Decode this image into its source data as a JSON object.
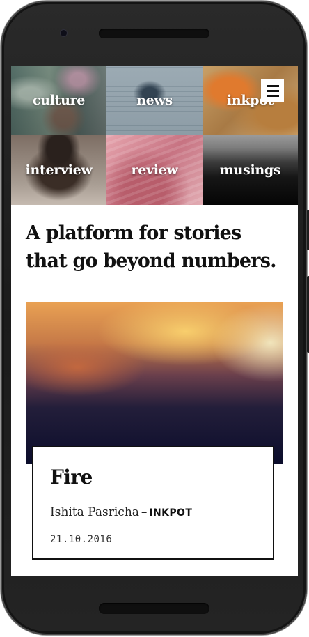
{
  "nav": {
    "tiles": [
      {
        "label": "culture"
      },
      {
        "label": "news"
      },
      {
        "label": "inkpot"
      },
      {
        "label": "interview"
      },
      {
        "label": "review"
      },
      {
        "label": "musings"
      }
    ],
    "menu_icon": "hamburger-menu-icon"
  },
  "tagline": "A platform for stories that go beyond numbers.",
  "featured": {
    "title": "Fire",
    "author": "Ishita Pasricha",
    "separator": "–",
    "category": "INKPOT",
    "date": "21.10.2016"
  }
}
